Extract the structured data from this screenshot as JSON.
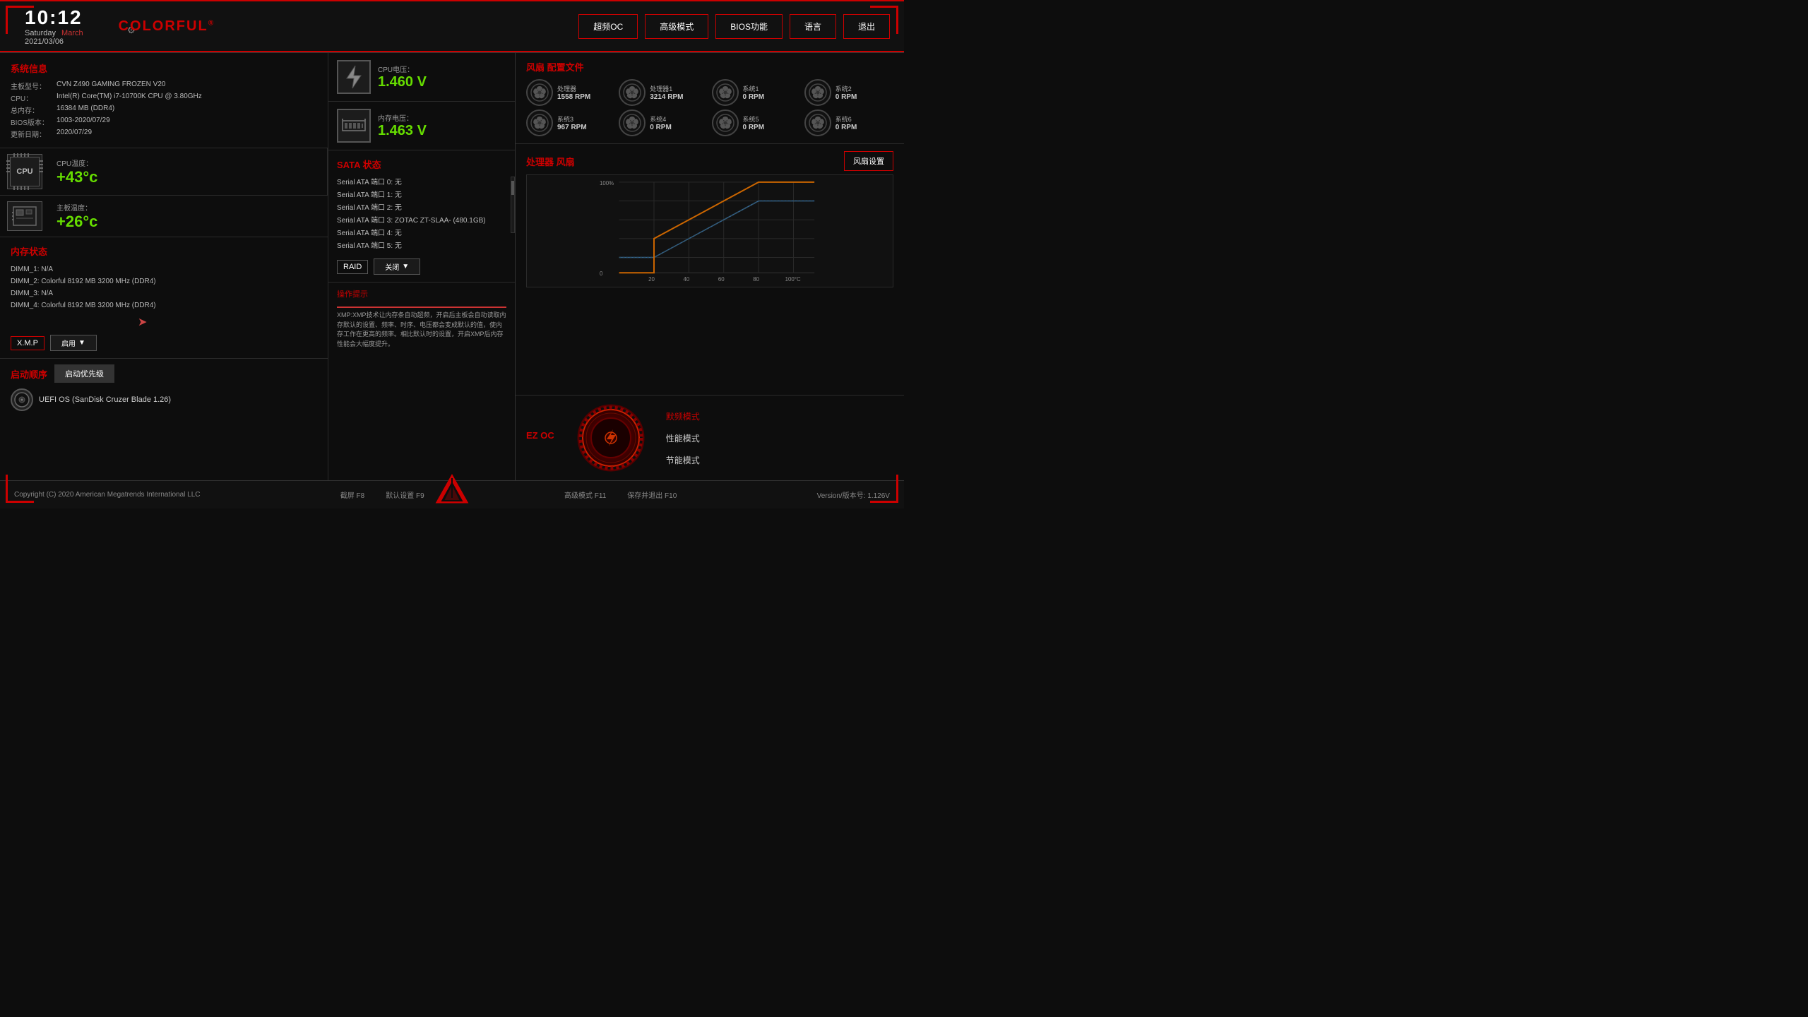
{
  "header": {
    "time": "10:12",
    "day": "Saturday",
    "month": "March",
    "date": "2021/03/06",
    "brand": "COLORFUL",
    "brand_reg": "®",
    "nav": {
      "oc": "超频OC",
      "advanced": "高级模式",
      "bios": "BIOS功能",
      "lang": "语言",
      "exit": "退出"
    }
  },
  "system_info": {
    "title": "系统信息",
    "board_label": "主板型号：",
    "board_value": "CVN Z490 GAMING FROZEN V20",
    "cpu_label": "CPU：",
    "cpu_value": "Intel(R) Core(TM) i7-10700K CPU @ 3.80GHz",
    "mem_label": "总内存：",
    "mem_value": "16384 MB (DDR4)",
    "bios_label": "BIOS版本：",
    "bios_value": "1003-2020/07/29",
    "update_label": "更新日期：",
    "update_value": "2020/07/29"
  },
  "metrics": {
    "cpu_temp_label": "CPU温度：",
    "cpu_temp_value": "+43°c",
    "cpu_volt_label": "CPU电压：",
    "cpu_volt_value": "1.460 V",
    "board_temp_label": "主板温度：",
    "board_temp_value": "+26°c",
    "mem_volt_label": "内存电压：",
    "mem_volt_value": "1.463 V"
  },
  "memory": {
    "title": "内存状态",
    "dimm1": "DIMM_1: N/A",
    "dimm2": "DIMM_2: Colorful 8192 MB 3200 MHz (DDR4)",
    "dimm3": "DIMM_3: N/A",
    "dimm4": "DIMM_4: Colorful 8192 MB 3200 MHz (DDR4)",
    "xmp_label": "X.M.P",
    "xmp_value": "启用",
    "xmp_dropdown": "▼"
  },
  "sata": {
    "title": "SATA 状态",
    "ports": [
      "Serial ATA 端口 0: 无",
      "Serial ATA 端口 1: 无",
      "Serial ATA 端口 2: 无",
      "Serial ATA 端口 3: ZOTAC ZT-SLAA- (480.1GB)",
      "Serial ATA 端口 4: 无",
      "Serial ATA 端口 5: 无"
    ],
    "raid_label": "RAID",
    "raid_value": "关闭",
    "raid_dropdown": "▼"
  },
  "boot": {
    "title": "启动顺序",
    "priority_btn": "启动优先级",
    "item": "UEFI OS (SanDisk Cruzer Blade 1.26)"
  },
  "tip": {
    "title": "操作提示",
    "content": "XMP:XMP技术让内存条自动超频，开启后主板会自动读取内存默认的设置、频率、时序、电压都会变成默认的值，使内存工作在更高的频率。相比默认时的设置，开启XMP后内存性能会大幅度提升。"
  },
  "fans": {
    "title": "风扇 配置文件",
    "items": [
      {
        "name": "处理器",
        "rpm": "1558 RPM"
      },
      {
        "name": "处理器1",
        "rpm": "3214 RPM"
      },
      {
        "name": "系统1",
        "rpm": "0 RPM"
      },
      {
        "name": "系统2",
        "rpm": "0 RPM"
      },
      {
        "name": "系统3",
        "rpm": "967 RPM"
      },
      {
        "name": "系统4",
        "rpm": "0 RPM"
      },
      {
        "name": "系统5",
        "rpm": "0 RPM"
      },
      {
        "name": "系统6",
        "rpm": "0 RPM"
      }
    ]
  },
  "fan_chart": {
    "title": "处理器 风扇",
    "settings_btn": "风扇设置",
    "y_max": "100%",
    "y_min": "0",
    "x_labels": [
      "20",
      "40",
      "60",
      "80",
      "100°C"
    ]
  },
  "ez_oc": {
    "title": "EZ OC",
    "default_label": "默频模式",
    "performance_label": "性能模式",
    "eco_label": "节能模式"
  },
  "footer": {
    "copyright": "Copyright (C) 2020 American Megatrends International LLC",
    "f8": "截屏 F8",
    "f9": "默认设置 F9",
    "f11": "高级模式 F11",
    "f10": "保存并退出 F10",
    "version": "Version/版本号: 1.126V"
  }
}
